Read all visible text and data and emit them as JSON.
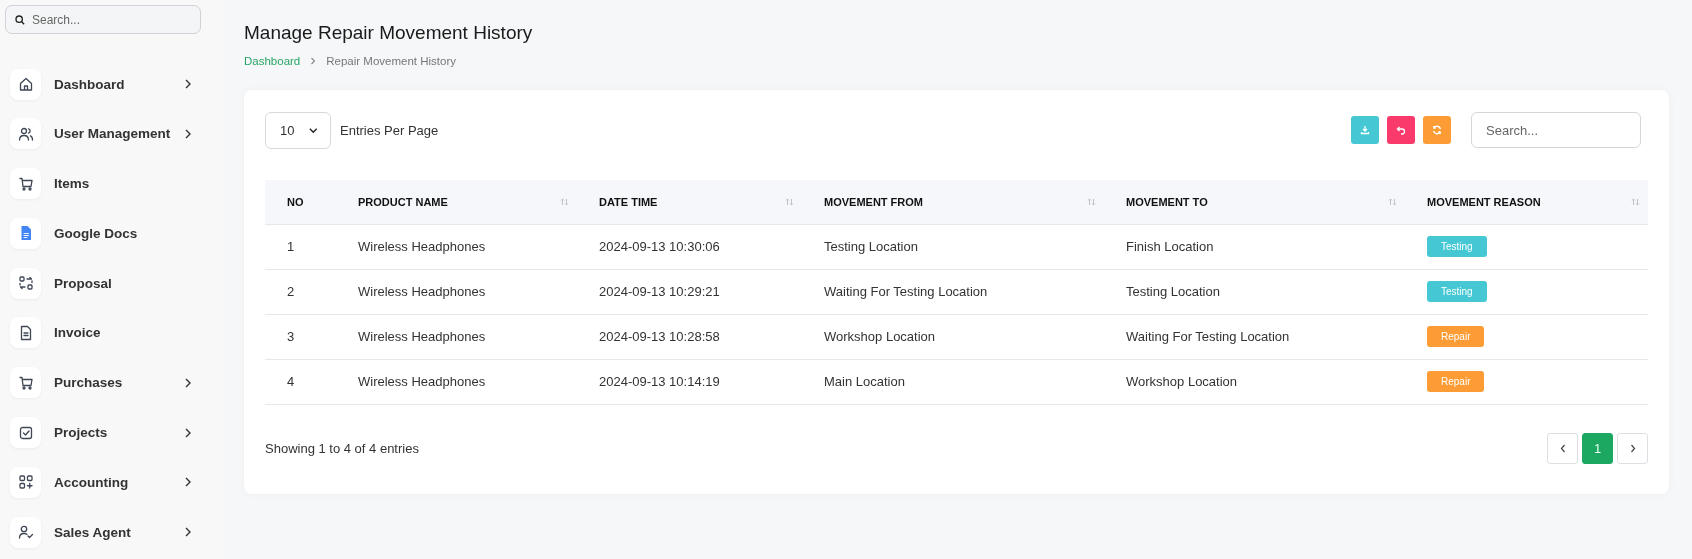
{
  "sidebar": {
    "search": {
      "placeholder": "Search..."
    },
    "items": [
      {
        "label": "Dashboard",
        "expandable": true
      },
      {
        "label": "User Management",
        "expandable": true
      },
      {
        "label": "Items",
        "expandable": false
      },
      {
        "label": "Google Docs",
        "expandable": false
      },
      {
        "label": "Proposal",
        "expandable": false
      },
      {
        "label": "Invoice",
        "expandable": false
      },
      {
        "label": "Purchases",
        "expandable": true
      },
      {
        "label": "Projects",
        "expandable": true
      },
      {
        "label": "Accounting",
        "expandable": true
      },
      {
        "label": "Sales Agent",
        "expandable": true
      }
    ]
  },
  "page": {
    "title": "Manage Repair Movement History",
    "breadcrumb": [
      "Dashboard",
      "Repair Movement History"
    ]
  },
  "toolbar": {
    "page_size": "10",
    "page_size_label": "Entries Per Page",
    "search": {
      "placeholder": "Search..."
    }
  },
  "table": {
    "columns": [
      {
        "label": "NO",
        "sortable": false
      },
      {
        "label": "PRODUCT NAME",
        "sortable": true
      },
      {
        "label": "DATE TIME",
        "sortable": true
      },
      {
        "label": "MOVEMENT FROM",
        "sortable": true
      },
      {
        "label": "MOVEMENT TO",
        "sortable": true
      },
      {
        "label": "MOVEMENT REASON",
        "sortable": true
      }
    ],
    "rows": [
      {
        "no": "1",
        "product": "Wireless Headphones",
        "datetime": "2024-09-13 10:30:06",
        "from": "Testing Location",
        "to": "Finish Location",
        "reason": {
          "text": "Testing",
          "color": "#45c8d4"
        }
      },
      {
        "no": "2",
        "product": "Wireless Headphones",
        "datetime": "2024-09-13 10:29:21",
        "from": "Waiting For Testing Location",
        "to": "Testing Location",
        "reason": {
          "text": "Testing",
          "color": "#45c8d4"
        }
      },
      {
        "no": "3",
        "product": "Wireless Headphones",
        "datetime": "2024-09-13 10:28:58",
        "from": "Workshop Location",
        "to": "Waiting For Testing Location",
        "reason": {
          "text": "Repair",
          "color": "#fd9c35"
        }
      },
      {
        "no": "4",
        "product": "Wireless Headphones",
        "datetime": "2024-09-13 10:14:19",
        "from": "Main Location",
        "to": "Workshop Location",
        "reason": {
          "text": "Repair",
          "color": "#fd9c35"
        }
      }
    ]
  },
  "footer": {
    "summary": "Showing 1 to 4 of 4 entries",
    "pages": [
      {
        "label": "1",
        "selected": true
      }
    ]
  }
}
